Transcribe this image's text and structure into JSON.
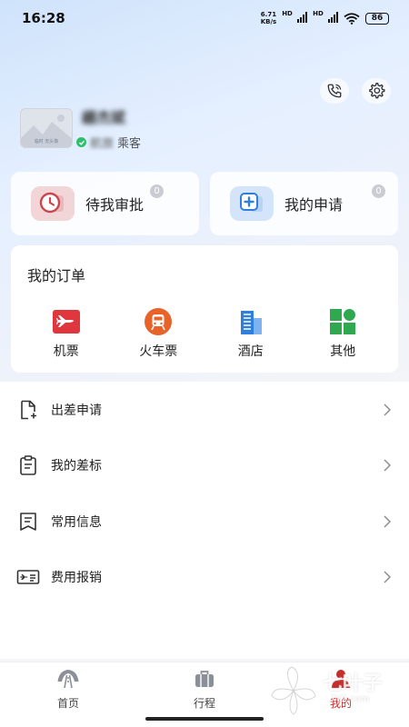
{
  "status_bar": {
    "time": "16:28",
    "net_speed_value": "6.71",
    "net_speed_unit": "KB/s",
    "hd_1": "HD",
    "hd_2": "HD",
    "battery": "86"
  },
  "header": {
    "icons": [
      "phone-icon",
      "settings-gear-icon"
    ]
  },
  "profile": {
    "avatar_caption": "临时 无头像",
    "name": "綳杰斌",
    "badge_text": "航旅",
    "sub_text": "乘客"
  },
  "quick_cards": [
    {
      "label": "待我审批",
      "badge": "0",
      "icon": "approval-clock-icon",
      "color": "#c8474f"
    },
    {
      "label": "我的申请",
      "badge": "0",
      "icon": "application-plus-icon",
      "color": "#2f7fe0"
    }
  ],
  "orders": {
    "title": "我的订单",
    "items": [
      {
        "label": "机票",
        "icon": "plane-icon",
        "color": "#e0363d"
      },
      {
        "label": "火车票",
        "icon": "train-icon",
        "color": "#e8632a"
      },
      {
        "label": "酒店",
        "icon": "hotel-building-icon",
        "color": "#2f7fe0"
      },
      {
        "label": "其他",
        "icon": "grid-other-icon",
        "color": "#2fa84f"
      }
    ]
  },
  "menu": [
    {
      "label": "出差申请",
      "icon": "document-add-icon"
    },
    {
      "label": "我的差标",
      "icon": "clipboard-icon"
    },
    {
      "label": "常用信息",
      "icon": "bookmark-list-icon"
    },
    {
      "label": "费用报销",
      "icon": "ticket-reimburse-icon"
    }
  ],
  "tabbar": {
    "tabs": [
      {
        "label": "首页",
        "icon": "home-road-icon",
        "active": false
      },
      {
        "label": "行程",
        "icon": "suitcase-icon",
        "active": false
      },
      {
        "label": "我的",
        "icon": "person-icon",
        "active": true
      }
    ]
  },
  "watermark": {
    "text": "七叶子",
    "url": "7Y2.com"
  },
  "colors": {
    "accent": "#c62e2e",
    "background": "#f4f5f7"
  }
}
